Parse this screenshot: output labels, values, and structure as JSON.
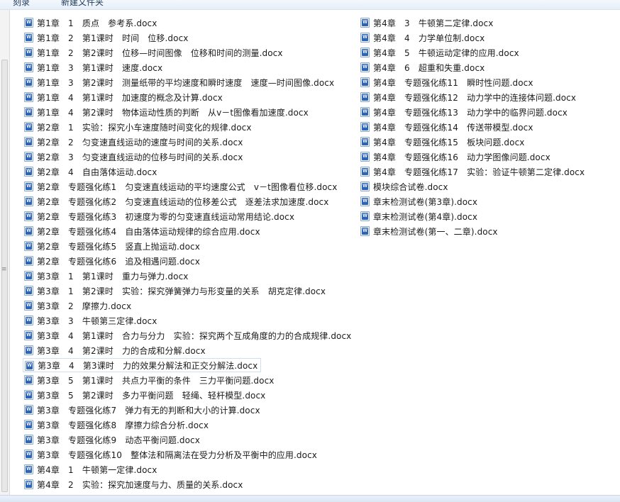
{
  "toolbar": {
    "share_label": "刻录",
    "new_folder_label": "新建文件夹"
  },
  "icons": {
    "file_icon": "word-document-icon",
    "splitter_icon": "grip-icon"
  },
  "files_left": [
    "第1章　1　质点　参考系.docx",
    "第1章　2　第1课时　时间　位移.docx",
    "第1章　2　第2课时　位移—时间图像　位移和时间的测量.docx",
    "第1章　3　第1课时　速度.docx",
    "第1章　3　第2课时　测量纸带的平均速度和瞬时速度　速度—时间图像.docx",
    "第1章　4　第1课时　加速度的概念及计算.docx",
    "第1章　4　第2课时　物体运动性质的判断　从v－t图像看加速度.docx",
    "第2章　1　实验：探究小车速度随时间变化的规律.docx",
    "第2章　2　匀变速直线运动的速度与时间的关系.docx",
    "第2章　3　匀变速直线运动的位移与时间的关系.docx",
    "第2章　4　自由落体运动.docx",
    "第2章　专题强化练1　匀变速直线运动的平均速度公式　v－t图像看位移.docx",
    "第2章　专题强化练2　匀变速直线运动的位移差公式　逐差法求加速度.docx",
    "第2章　专题强化练3　初速度为零的匀变速直线运动常用结论.docx",
    "第2章　专题强化练4　自由落体运动规律的综合应用.docx",
    "第2章　专题强化练5　竖直上抛运动.docx",
    "第2章　专题强化练6　追及相遇问题.docx",
    "第3章　1　第1课时　重力与弹力.docx",
    "第3章　1　第2课时　实验：探究弹簧弹力与形变量的关系　胡克定律.docx",
    "第3章　2　摩擦力.docx",
    "第3章　3　牛顿第三定律.docx",
    "第3章　4　第1课时　合力与分力　实验：探究两个互成角度的力的合成规律.docx",
    "第3章　4　第2课时　力的合成和分解.docx",
    "第3章　4　第3课时　力的效果分解法和正交分解法.docx",
    "第3章　5　第1课时　共点力平衡的条件　三力平衡问题.docx",
    "第3章　5　第2课时　多力平衡问题　轻绳、轻杆模型.docx",
    "第3章　专题强化练7　弹力有无的判断和大小的计算.docx",
    "第3章　专题强化练8　摩擦力综合分析.docx",
    "第3章　专题强化练9　动态平衡问题.docx",
    "第3章　专题强化练10　整体法和隔离法在受力分析及平衡中的应用.docx",
    "第4章　1　牛顿第一定律.docx",
    "第4章　2　实验：探究加速度与力、质量的关系.docx"
  ],
  "files_right": [
    "第4章　3　牛顿第二定律.docx",
    "第4章　4　力学单位制.docx",
    "第4章　5　牛顿运动定律的应用.docx",
    "第4章　6　超重和失重.docx",
    "第4章　专题强化练11　瞬时性问题.docx",
    "第4章　专题强化练12　动力学中的连接体问题.docx",
    "第4章　专题强化练13　动力学中的临界问题.docx",
    "第4章　专题强化练14　传送带模型.docx",
    "第4章　专题强化练15　板块问题.docx",
    "第4章　专题强化练16　动力学图像问题.docx",
    "第4章　专题强化练17　实验：验证牛顿第二定律.docx",
    "模块综合试卷.docx",
    "章末检测试卷(第3章).docx",
    "章末检测试卷(第4章).docx",
    "章末检测试卷(第一、二章).docx"
  ],
  "selected_index_left": 23
}
